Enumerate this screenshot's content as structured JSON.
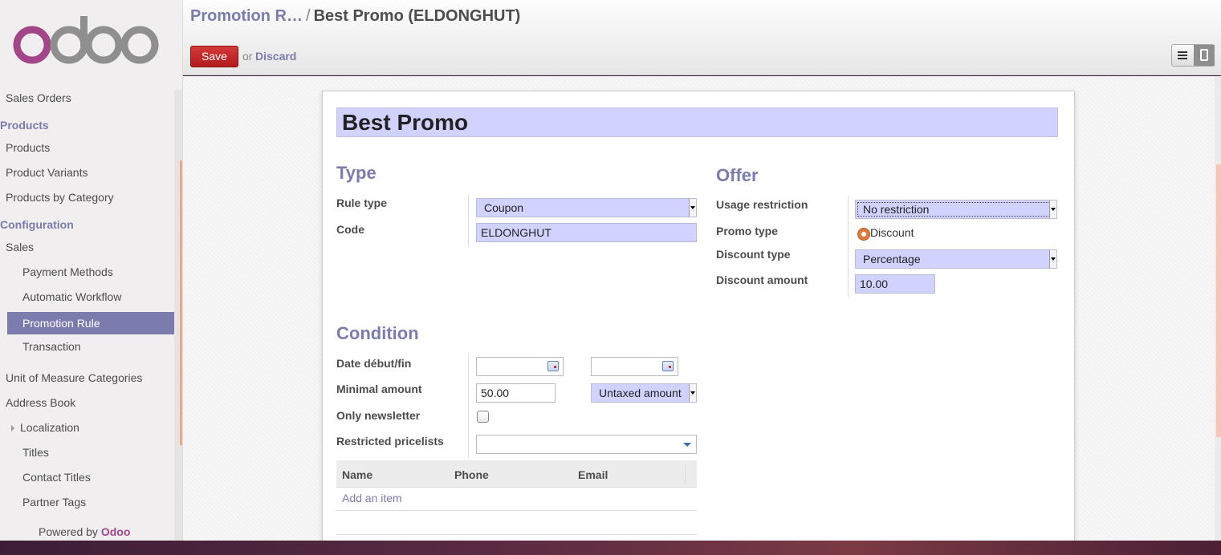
{
  "brand": {
    "logo_text": "odoo",
    "powered_prefix": "Powered by",
    "powered_brand": "Odoo"
  },
  "sidebar": {
    "items": [
      {
        "label": "Sales Orders"
      },
      {
        "label": "Products",
        "heading": true
      },
      {
        "label": "Products"
      },
      {
        "label": "Product Variants"
      },
      {
        "label": "Products by Category"
      },
      {
        "label": "Configuration",
        "heading": true
      },
      {
        "label": "Sales"
      },
      {
        "label": "Payment Methods"
      },
      {
        "label": "Automatic Workflow"
      },
      {
        "label": "Promotion Rule",
        "active": true
      },
      {
        "label": "Transaction"
      },
      {
        "label": "Unit of Measure Categories"
      },
      {
        "label": "Address Book"
      },
      {
        "label": "Localization"
      },
      {
        "label": "Titles"
      },
      {
        "label": "Contact Titles"
      },
      {
        "label": "Partner Tags"
      }
    ]
  },
  "header": {
    "breadcrumb_parent": "Promotion R…",
    "breadcrumb_sep": "/",
    "breadcrumb_current": "Best Promo (ELDONGHUT)",
    "save_label": "Save",
    "or_label": "or",
    "discard_label": "Discard"
  },
  "form": {
    "name": "Best Promo",
    "type_section": {
      "title": "Type",
      "rule_type_label": "Rule type",
      "rule_type_value": "Coupon",
      "code_label": "Code",
      "code_value": "ELDONGHUT"
    },
    "offer_section": {
      "title": "Offer",
      "usage_restriction_label": "Usage restriction",
      "usage_restriction_value": "No restriction",
      "promo_type_label": "Promo type",
      "promo_type_value": "Discount",
      "discount_type_label": "Discount type",
      "discount_type_value": "Percentage",
      "discount_amount_label": "Discount amount",
      "discount_amount_value": "10.00"
    },
    "condition_section": {
      "title": "Condition",
      "date_label": "Date début/fin",
      "date_start": "",
      "date_end": "",
      "minimal_amount_label": "Minimal amount",
      "minimal_amount_value": "50.00",
      "amount_type_value": "Untaxed amount",
      "only_newsletter_label": "Only newsletter",
      "only_newsletter_checked": false,
      "restricted_pricelists_label": "Restricted pricelists",
      "restricted_pricelists_value": ""
    },
    "table": {
      "columns": [
        "Name",
        "Phone",
        "Email"
      ],
      "add_item_label": "Add an item"
    }
  },
  "colors": {
    "accent": "#7c7bad",
    "save_button": "#c62828",
    "required_field": "#d2d2ff",
    "brand_purple": "#a24689"
  }
}
